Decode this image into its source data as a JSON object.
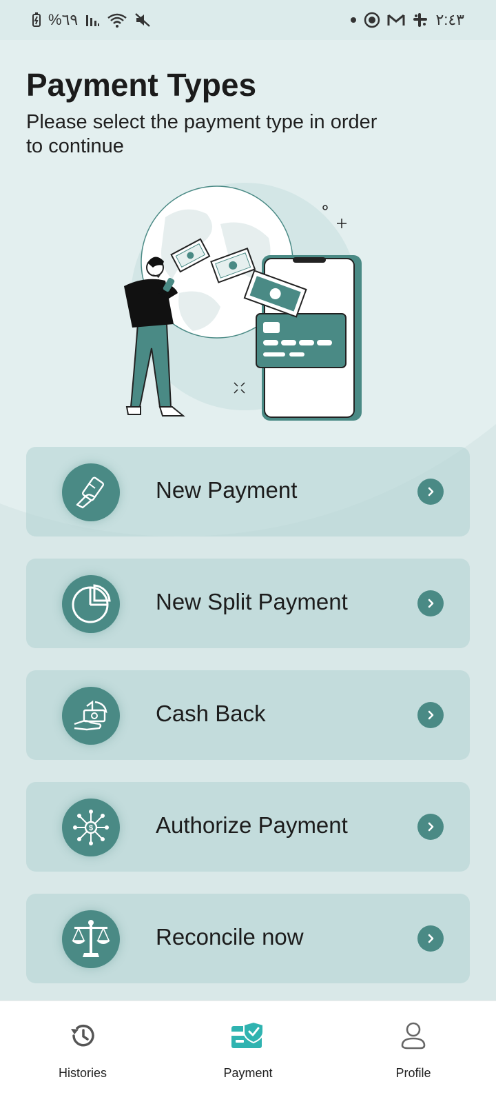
{
  "status_bar": {
    "battery": "%٦٩",
    "time": "٢:٤٣",
    "icons": [
      "battery-icon",
      "signal-icon",
      "wifi-icon",
      "mute-icon",
      "dot-icon",
      "app-icon",
      "gmail-icon",
      "slack-icon"
    ]
  },
  "header": {
    "title": "Payment Types",
    "subtitle": "Please select the payment type in order to continue"
  },
  "options": [
    {
      "label": "New Payment",
      "icon": "card-hand-icon"
    },
    {
      "label": "New Split Payment",
      "icon": "pie-chart-icon"
    },
    {
      "label": "Cash Back",
      "icon": "cash-back-icon"
    },
    {
      "label": "Authorize Payment",
      "icon": "network-dollar-icon"
    },
    {
      "label": "Reconcile now",
      "icon": "scale-icon"
    }
  ],
  "bottom_nav": {
    "items": [
      {
        "label": "Histories",
        "icon": "history-icon"
      },
      {
        "label": "Payment",
        "icon": "payment-card-icon",
        "active": true
      },
      {
        "label": "Profile",
        "icon": "profile-icon"
      }
    ]
  },
  "colors": {
    "accent": "#4a8a85",
    "active_nav": "#2fb3b0",
    "card_bg": "#cfe3e3",
    "bg_light": "#e3efef"
  }
}
